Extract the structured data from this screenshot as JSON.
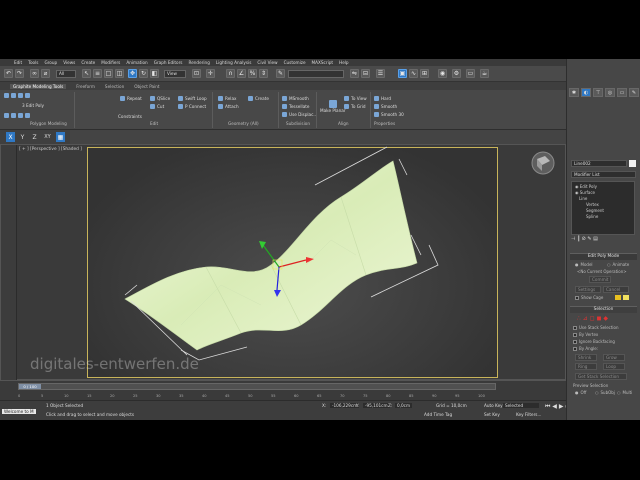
{
  "menu": [
    "Edit",
    "Tools",
    "Group",
    "Views",
    "Create",
    "Modifiers",
    "Animation",
    "Graph Editors",
    "Rendering",
    "Lighting Analysis",
    "Civil View",
    "Customize",
    "MAXScript",
    "Help"
  ],
  "toolbar": {
    "selection_filter": "All",
    "ref_coord": "View"
  },
  "ribbon": {
    "tabs": [
      "Graphite Modeling Tools",
      "Freeform",
      "Selection",
      "Object Paint"
    ],
    "active_tab": "Graphite Modeling Tools",
    "left_label": "3 Edit Poly",
    "poly_modeling": "Polygon Modeling",
    "edit_items": [
      "Repeat",
      "QSlice",
      "Swift Loop",
      "Cut",
      "P Connect",
      "Constraints"
    ],
    "geometry_items": [
      "Relax",
      "Create",
      "Attach"
    ],
    "subdiv_items": [
      "MSmooth",
      "Tessellate",
      "Use Displac..."
    ],
    "align_items": [
      "Make Planar",
      "To View",
      "To Grid"
    ],
    "props_items": [
      "Hard",
      "Smooth",
      "Smooth 30"
    ],
    "groups": [
      "Edit",
      "Geometry (All)",
      "Subdivision",
      "Align",
      "Properties"
    ]
  },
  "axes": {
    "x": "X",
    "y": "Y",
    "z": "Z",
    "xy": "XY"
  },
  "viewport": {
    "label": "[ + ] [Perspective ] [Shaded ]"
  },
  "command_panel": {
    "object_name": "Line002",
    "modifier_list": "Modifier List",
    "stack": [
      "Edit Poly",
      "Surface",
      "Line",
      "Vertex",
      "Segment",
      "Spline"
    ],
    "rollout_mode": "Edit Poly Mode",
    "model_label": "Model",
    "animate_label": "Animate",
    "no_op": "<No Current Operation>",
    "commit": "Commit",
    "settings": "Settings",
    "cancel": "Cancel",
    "show_cage": "Show Cage",
    "rollout_selection": "Selection",
    "sel_options": [
      "Use Stack Selection",
      "By Vertex",
      "Ignore Backfacing",
      "By Angle:",
      "Shrink",
      "Grow",
      "Ring",
      "Loop",
      "Get Stack Selection"
    ],
    "preview_selection": "Preview Selection",
    "preview_off": "Off",
    "subobj": "SubObj",
    "multi": "Multi"
  },
  "timeline": {
    "frame": "0 / 100",
    "ticks": [
      "0",
      "5",
      "10",
      "15",
      "20",
      "25",
      "30",
      "35",
      "40",
      "45",
      "50",
      "55",
      "60",
      "65",
      "70",
      "75",
      "80",
      "85",
      "90",
      "95",
      "100"
    ]
  },
  "status": {
    "welcome": "Welcome to M",
    "selected": "1 Object Selected",
    "prompt": "Click and drag to select and move objects",
    "x_label": "X:",
    "x_val": "-106,229cm",
    "y_label": "Y:",
    "y_val": "-95,101cm",
    "z_label": "Z:",
    "z_val": "0,0cm",
    "grid": "Grid = 10,0cm",
    "add_time_tag": "Add Time Tag",
    "auto_key": "Auto Key",
    "selected_dd": "Selected",
    "set_key": "Set Key",
    "key_filters": "Key Filters..."
  },
  "watermark": "digitales-entwerfen.de",
  "colors": {
    "surface": "#e4f2c8",
    "accent_blue": "#2f78c4",
    "safe_frame": "#c8b45a"
  }
}
